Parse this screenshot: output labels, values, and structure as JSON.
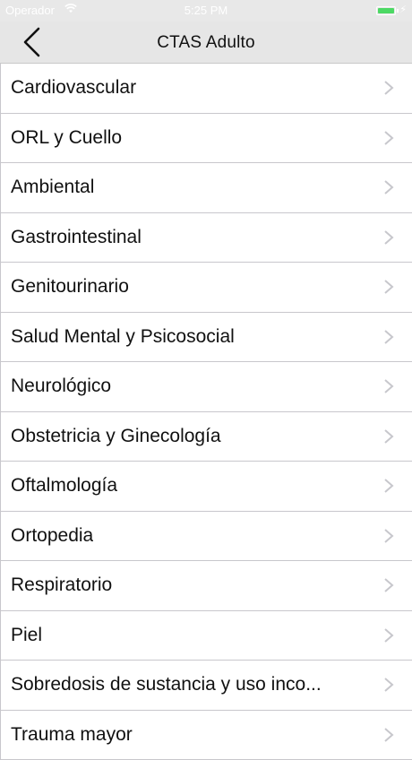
{
  "status_bar": {
    "carrier": "Operador",
    "time": "5:25 PM",
    "battery_level": 1.0
  },
  "nav": {
    "title": "CTAS Adulto"
  },
  "list": {
    "items": [
      {
        "label": "Cardiovascular"
      },
      {
        "label": "ORL y Cuello"
      },
      {
        "label": "Ambiental"
      },
      {
        "label": "Gastrointestinal"
      },
      {
        "label": "Genitourinario"
      },
      {
        "label": "Salud Mental y Psicosocial"
      },
      {
        "label": "Neurológico"
      },
      {
        "label": "Obstetricia y Ginecología"
      },
      {
        "label": "Oftalmología"
      },
      {
        "label": "Ortopedia"
      },
      {
        "label": "Respiratorio"
      },
      {
        "label": "Piel"
      },
      {
        "label": "Sobredosis de sustancia y uso inco..."
      },
      {
        "label": "Trauma mayor"
      }
    ]
  },
  "colors": {
    "battery": "#4cd964",
    "navbar_bg": "#e6e6e6",
    "separator": "#c8c7cc",
    "chevron": "#c7c7cc"
  }
}
